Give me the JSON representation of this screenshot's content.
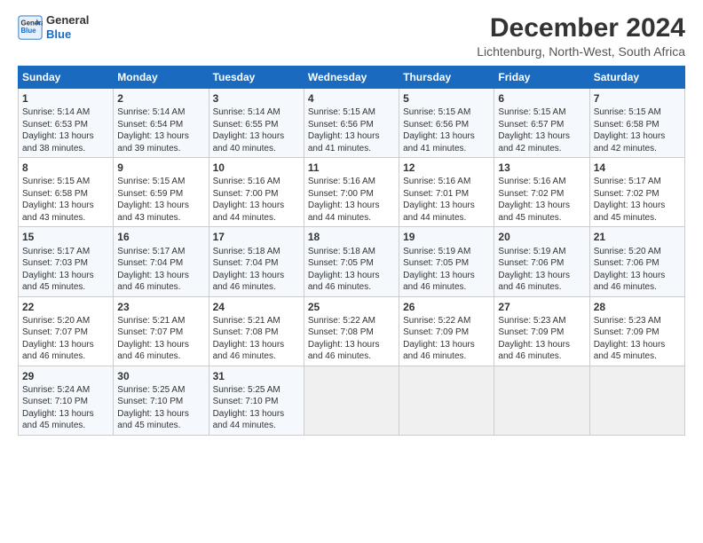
{
  "header": {
    "logo_line1": "General",
    "logo_line2": "Blue",
    "title": "December 2024",
    "subtitle": "Lichtenburg, North-West, South Africa"
  },
  "days_of_week": [
    "Sunday",
    "Monday",
    "Tuesday",
    "Wednesday",
    "Thursday",
    "Friday",
    "Saturday"
  ],
  "weeks": [
    [
      {
        "day": "1",
        "info": "Sunrise: 5:14 AM\nSunset: 6:53 PM\nDaylight: 13 hours\nand 38 minutes."
      },
      {
        "day": "2",
        "info": "Sunrise: 5:14 AM\nSunset: 6:54 PM\nDaylight: 13 hours\nand 39 minutes."
      },
      {
        "day": "3",
        "info": "Sunrise: 5:14 AM\nSunset: 6:55 PM\nDaylight: 13 hours\nand 40 minutes."
      },
      {
        "day": "4",
        "info": "Sunrise: 5:15 AM\nSunset: 6:56 PM\nDaylight: 13 hours\nand 41 minutes."
      },
      {
        "day": "5",
        "info": "Sunrise: 5:15 AM\nSunset: 6:56 PM\nDaylight: 13 hours\nand 41 minutes."
      },
      {
        "day": "6",
        "info": "Sunrise: 5:15 AM\nSunset: 6:57 PM\nDaylight: 13 hours\nand 42 minutes."
      },
      {
        "day": "7",
        "info": "Sunrise: 5:15 AM\nSunset: 6:58 PM\nDaylight: 13 hours\nand 42 minutes."
      }
    ],
    [
      {
        "day": "8",
        "info": "Sunrise: 5:15 AM\nSunset: 6:58 PM\nDaylight: 13 hours\nand 43 minutes."
      },
      {
        "day": "9",
        "info": "Sunrise: 5:15 AM\nSunset: 6:59 PM\nDaylight: 13 hours\nand 43 minutes."
      },
      {
        "day": "10",
        "info": "Sunrise: 5:16 AM\nSunset: 7:00 PM\nDaylight: 13 hours\nand 44 minutes."
      },
      {
        "day": "11",
        "info": "Sunrise: 5:16 AM\nSunset: 7:00 PM\nDaylight: 13 hours\nand 44 minutes."
      },
      {
        "day": "12",
        "info": "Sunrise: 5:16 AM\nSunset: 7:01 PM\nDaylight: 13 hours\nand 44 minutes."
      },
      {
        "day": "13",
        "info": "Sunrise: 5:16 AM\nSunset: 7:02 PM\nDaylight: 13 hours\nand 45 minutes."
      },
      {
        "day": "14",
        "info": "Sunrise: 5:17 AM\nSunset: 7:02 PM\nDaylight: 13 hours\nand 45 minutes."
      }
    ],
    [
      {
        "day": "15",
        "info": "Sunrise: 5:17 AM\nSunset: 7:03 PM\nDaylight: 13 hours\nand 45 minutes."
      },
      {
        "day": "16",
        "info": "Sunrise: 5:17 AM\nSunset: 7:04 PM\nDaylight: 13 hours\nand 46 minutes."
      },
      {
        "day": "17",
        "info": "Sunrise: 5:18 AM\nSunset: 7:04 PM\nDaylight: 13 hours\nand 46 minutes."
      },
      {
        "day": "18",
        "info": "Sunrise: 5:18 AM\nSunset: 7:05 PM\nDaylight: 13 hours\nand 46 minutes."
      },
      {
        "day": "19",
        "info": "Sunrise: 5:19 AM\nSunset: 7:05 PM\nDaylight: 13 hours\nand 46 minutes."
      },
      {
        "day": "20",
        "info": "Sunrise: 5:19 AM\nSunset: 7:06 PM\nDaylight: 13 hours\nand 46 minutes."
      },
      {
        "day": "21",
        "info": "Sunrise: 5:20 AM\nSunset: 7:06 PM\nDaylight: 13 hours\nand 46 minutes."
      }
    ],
    [
      {
        "day": "22",
        "info": "Sunrise: 5:20 AM\nSunset: 7:07 PM\nDaylight: 13 hours\nand 46 minutes."
      },
      {
        "day": "23",
        "info": "Sunrise: 5:21 AM\nSunset: 7:07 PM\nDaylight: 13 hours\nand 46 minutes."
      },
      {
        "day": "24",
        "info": "Sunrise: 5:21 AM\nSunset: 7:08 PM\nDaylight: 13 hours\nand 46 minutes."
      },
      {
        "day": "25",
        "info": "Sunrise: 5:22 AM\nSunset: 7:08 PM\nDaylight: 13 hours\nand 46 minutes."
      },
      {
        "day": "26",
        "info": "Sunrise: 5:22 AM\nSunset: 7:09 PM\nDaylight: 13 hours\nand 46 minutes."
      },
      {
        "day": "27",
        "info": "Sunrise: 5:23 AM\nSunset: 7:09 PM\nDaylight: 13 hours\nand 46 minutes."
      },
      {
        "day": "28",
        "info": "Sunrise: 5:23 AM\nSunset: 7:09 PM\nDaylight: 13 hours\nand 45 minutes."
      }
    ],
    [
      {
        "day": "29",
        "info": "Sunrise: 5:24 AM\nSunset: 7:10 PM\nDaylight: 13 hours\nand 45 minutes."
      },
      {
        "day": "30",
        "info": "Sunrise: 5:25 AM\nSunset: 7:10 PM\nDaylight: 13 hours\nand 45 minutes."
      },
      {
        "day": "31",
        "info": "Sunrise: 5:25 AM\nSunset: 7:10 PM\nDaylight: 13 hours\nand 44 minutes."
      },
      {
        "day": "",
        "info": ""
      },
      {
        "day": "",
        "info": ""
      },
      {
        "day": "",
        "info": ""
      },
      {
        "day": "",
        "info": ""
      }
    ]
  ]
}
